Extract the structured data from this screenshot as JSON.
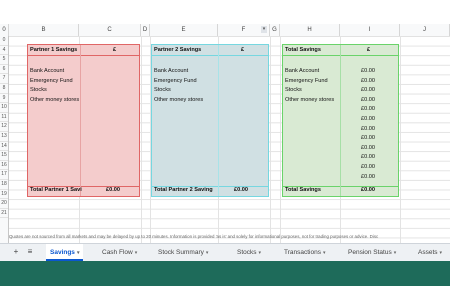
{
  "columns": [
    "0",
    "B",
    "C",
    "D",
    "E",
    "F",
    "G",
    "H",
    "I",
    "J"
  ],
  "rows": [
    "0",
    "4",
    "5",
    "6",
    "7",
    "8",
    "9",
    "10",
    "11",
    "12",
    "13",
    "14",
    "15",
    "16",
    "17",
    "18",
    "19",
    "20",
    "21"
  ],
  "partner1": {
    "header": "Partner 1 Savings",
    "currency": "£",
    "items": [
      "Bank Account",
      "Emergency Fund",
      "Stocks",
      "Other money stores"
    ],
    "total_label": "Total Partner 1 Savi",
    "total_value": "£0.00",
    "fill": "#f4cccc",
    "border": "#e06666"
  },
  "partner2": {
    "header": "Partner 2 Savings",
    "currency": "£",
    "items": [
      "Bank Account",
      "Emergency Fund",
      "Stocks",
      "Other money stores"
    ],
    "total_label": "Total Partner 2 Saving",
    "total_value": "£0.00",
    "fill": "#d0e0e3",
    "border": "#76d7e0"
  },
  "total": {
    "header": "Total Savings",
    "currency": "£",
    "items": [
      "Bank Account",
      "Emergency Fund",
      "Stocks",
      "Other money stores"
    ],
    "values": [
      "£0.00",
      "£0.00",
      "£0.00",
      "£0.00",
      "£0.00",
      "£0.00",
      "£0.00",
      "£0.00",
      "£0.00",
      "£0.00",
      "£0.00",
      "£0.00"
    ],
    "total_label": "Total Savings",
    "total_value": "£0.00",
    "fill": "#d9ead3",
    "border": "#6ad36a"
  },
  "disclaimer": "Quotes are not sourced from all markets and may be delayed by up to 20 minutes. Information is provided 'as is' and solely for informational purposes, not for trading purposes or advice. Disc",
  "tabs": [
    {
      "label": "Savings",
      "active": true
    },
    {
      "label": "Cash Flow",
      "active": false
    },
    {
      "label": "Stock Summary",
      "active": false
    },
    {
      "label": "Stocks",
      "active": false
    },
    {
      "label": "Transactions",
      "active": false
    },
    {
      "label": "Pension Status",
      "active": false
    },
    {
      "label": "Assets",
      "active": false
    }
  ],
  "icons": {
    "add": "plus-icon",
    "list": "menu-icon",
    "dropdown": "chevron-down-icon"
  }
}
